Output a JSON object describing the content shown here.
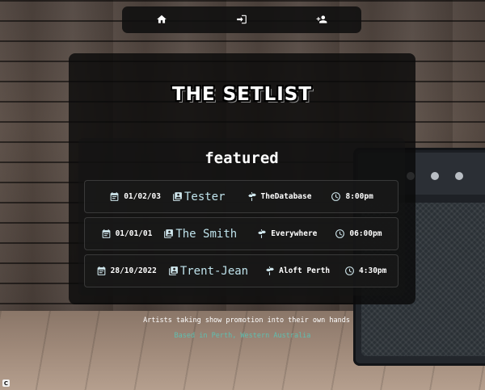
{
  "nav": {
    "items": [
      {
        "icon": "home-icon"
      },
      {
        "icon": "login-icon"
      },
      {
        "icon": "add-user-icon"
      }
    ]
  },
  "site": {
    "title": "THE SETLIST"
  },
  "featured": {
    "heading": "featured",
    "events": [
      {
        "date": "01/02/03",
        "artist": "Tester",
        "venue": "TheDatabase",
        "time": "8:00pm"
      },
      {
        "date": "01/01/01",
        "artist": "The Smith",
        "venue": "Everywhere",
        "time": "06:00pm"
      },
      {
        "date": "28/10/2022",
        "artist": "Trent-Jean",
        "venue": "Aloft Perth",
        "time": "4:30pm"
      }
    ]
  },
  "footer": {
    "tagline": "Artists taking show promotion into their own hands",
    "location": "Based in Perth, Western Australia"
  },
  "corner_badge": "C",
  "colors": {
    "artist_text": "#bfe3ec",
    "location_text": "#5fbfb0",
    "panel_bg": "#0a0a0a"
  }
}
